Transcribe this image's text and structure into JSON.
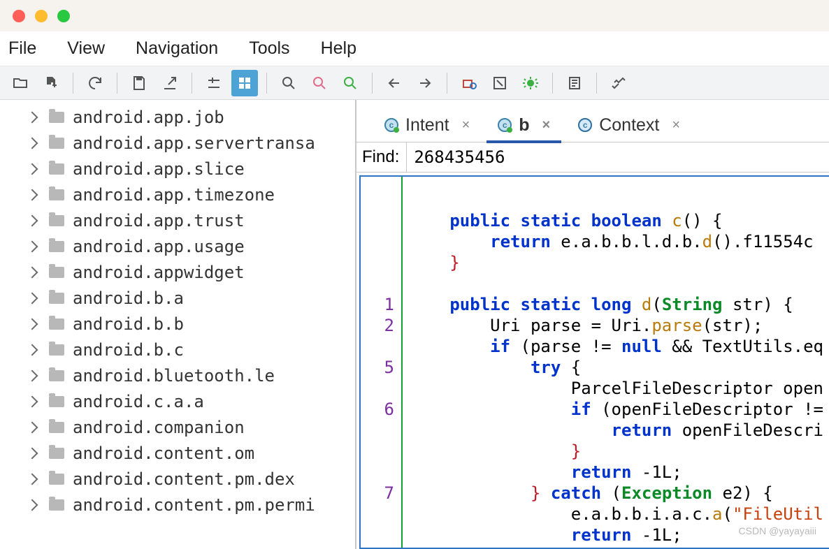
{
  "menus": {
    "file": "File",
    "view": "View",
    "navigation": "Navigation",
    "tools": "Tools",
    "help": "Help"
  },
  "sidebar": {
    "items": [
      "android.app.job",
      "android.app.servertransa",
      "android.app.slice",
      "android.app.timezone",
      "android.app.trust",
      "android.app.usage",
      "android.appwidget",
      "android.b.a",
      "android.b.b",
      "android.b.c",
      "android.bluetooth.le",
      "android.c.a.a",
      "android.companion",
      "android.content.om",
      "android.content.pm.dex",
      "android.content.pm.permi"
    ]
  },
  "tabs": [
    {
      "label": "Intent",
      "active": false
    },
    {
      "label": "b",
      "active": true
    },
    {
      "label": "Context",
      "active": false
    }
  ],
  "find": {
    "label": "Find:",
    "value": "268435456"
  },
  "gutter": [
    "",
    "",
    "",
    "",
    "",
    "1",
    "2",
    "",
    "5",
    "",
    "6",
    "",
    "",
    "",
    "7",
    ""
  ],
  "code": {
    "l1": "public static boolean",
    "l1b": " c",
    "l1c": "() {",
    "l2": "return",
    "l2b": " e.a.b.b.l.d.b.",
    "l2c": "d",
    "l2d": "().f11554c",
    "l5": "public static long",
    "l5b": " d",
    "l5c": "(",
    "l5d": "String",
    "l5e": " str) {",
    "l6": "Uri parse = Uri.",
    "l6b": "parse",
    "l6c": "(str);",
    "l7": "if",
    "l7b": " (parse != ",
    "l7c": "null",
    "l7d": " && TextUtils.eq",
    "l8": "try",
    "l8b": " {",
    "l9": "ParcelFileDescriptor open",
    "l10": "if",
    "l10b": " (openFileDescriptor !=",
    "l11": "return",
    "l11b": " openFileDescri",
    "l13": "return",
    "l13b": " -1L;",
    "l14": "catch",
    "l14b": " (",
    "l14c": "Exception",
    "l14d": " e2) {",
    "l15": "e.a.b.b.i.a.c.",
    "l15b": "a",
    "l15c": "(",
    "l15d": "\"FileUtil",
    "l16": "return",
    "l16b": " -1L;"
  },
  "watermark": "CSDN @yayayaiii"
}
